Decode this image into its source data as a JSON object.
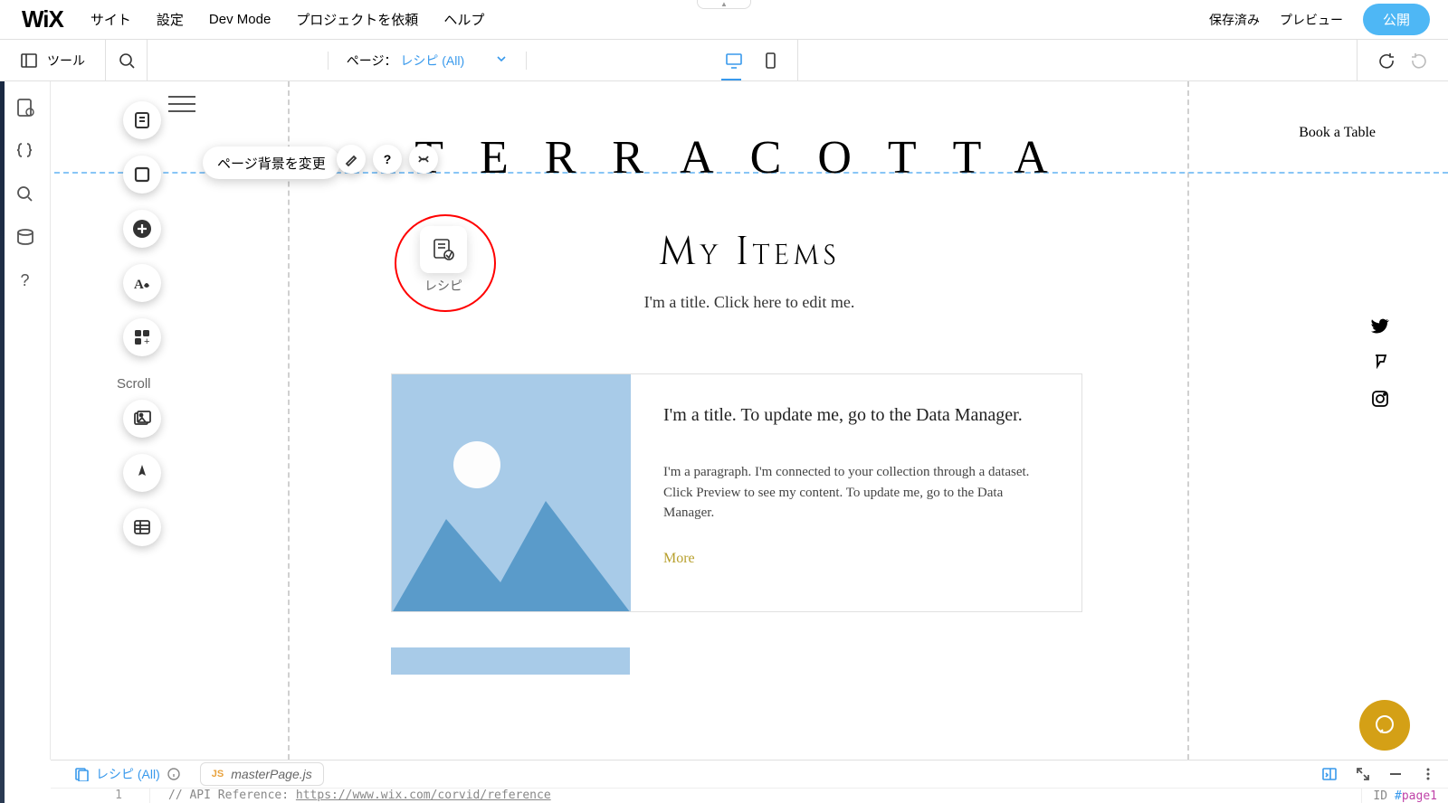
{
  "top_menu": {
    "logo": "WiX",
    "items": [
      "サイト",
      "設定",
      "Dev Mode",
      "プロジェクトを依頼",
      "ヘルプ"
    ],
    "saved": "保存済み",
    "preview": "プレビュー",
    "publish": "公開"
  },
  "second_bar": {
    "tools": "ツール",
    "page_label": "ページ：",
    "page_name": "レシピ (All)"
  },
  "context_bar": {
    "bg_change": "ページ背景を変更"
  },
  "canvas": {
    "site_title": "TERRACOTTA",
    "book_table": "Book a Table",
    "my_items": "My Items",
    "subtitle": "I'm a title. Click here to edit me.",
    "card": {
      "title": "I'm a title. To update me, go to the Data Manager.",
      "para": "I'm a paragraph. I'm connected to your collection through a dataset. Click Preview to see my content. To update me, go to the Data Manager.",
      "more": "More"
    },
    "dataset_label": "レシピ",
    "scroll": "Scroll"
  },
  "code_panel": {
    "tab1": "レシピ (All)",
    "tab2": "masterPage.js",
    "line_no": "1",
    "comment_prefix": "// API Reference: ",
    "comment_url": "https://www.wix.com/corvid/reference",
    "id_label": "ID",
    "id_hash": "#",
    "id_value": "page1"
  }
}
